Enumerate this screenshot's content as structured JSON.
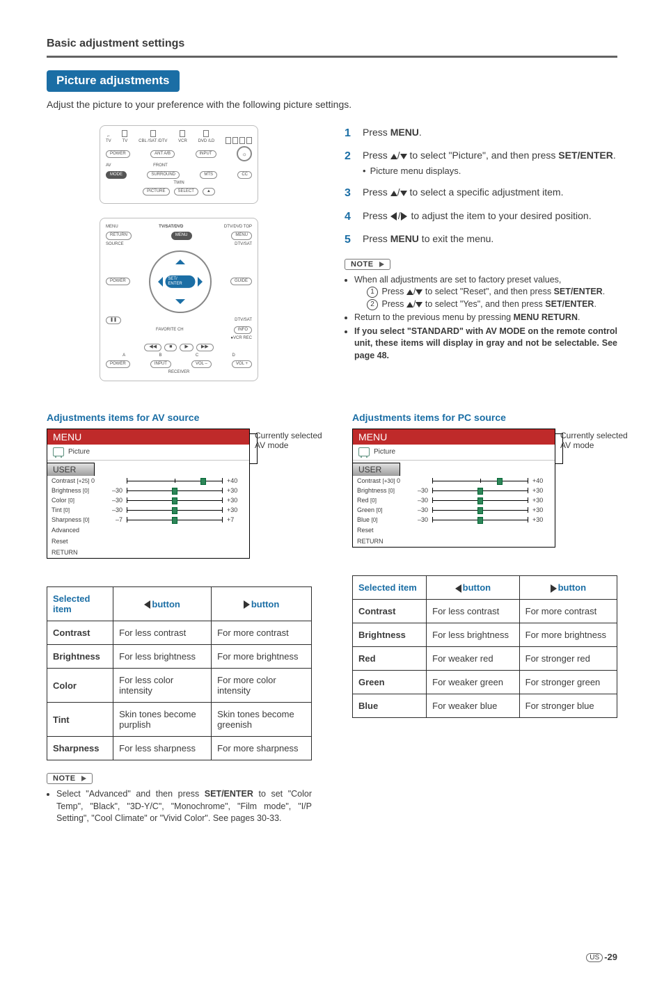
{
  "header": {
    "section_title": "Basic adjustment settings",
    "pill": "Picture adjustments",
    "intro": "Adjust the picture to your preference with the following picture settings."
  },
  "remote_top": {
    "icons": [
      "TV",
      "TV",
      "CBL /SAT /DTV",
      "VCR",
      "DVD /LD"
    ],
    "row1": [
      "POWER",
      "ANT A/B",
      "INPUT"
    ],
    "row1_group_l": "AV",
    "row1_group_r": "FRONT",
    "row2": [
      "MODE",
      "SURROUND",
      "MTS",
      "CC"
    ],
    "row3_l": "TWIN",
    "row3": [
      "PICTURE",
      "SELECT"
    ],
    "row3_tri": "▲"
  },
  "remote_bottom": {
    "top_l": "MENU",
    "top_c": "TV/SAT/DVD",
    "top_r": "DTV/DVD TOP",
    "row1": [
      "RETURN",
      "MENU",
      "MENU"
    ],
    "src": "SOURCE",
    "dtv_sat": "DTV/SAT",
    "row2": [
      "POWER",
      "GUIDE"
    ],
    "center": "SET/ ENTER",
    "info": "INFO",
    "fav": "FAVORITE CH",
    "vcr": "VCR REC",
    "transport": [
      "◀◀",
      "■",
      "▶",
      "▶▶"
    ],
    "pause": "❚❚",
    "abcd": [
      "A",
      "B",
      "C",
      "D"
    ],
    "bottom": [
      "POWER",
      "INPUT",
      "VOL –",
      "VOL +"
    ],
    "receiver": "RECEIVER"
  },
  "steps": [
    {
      "n": "1",
      "html": "Press <b>MENU</b>."
    },
    {
      "n": "2",
      "html": "Press ▲/▼ to select \"Picture\", and then press <b>SET/ENTER</b>.",
      "sub": "Picture menu displays."
    },
    {
      "n": "3",
      "html": "Press ▲/▼ to select a specific adjustment item."
    },
    {
      "n": "4",
      "html": "Press ◀/▶ to adjust the item to your desired position."
    },
    {
      "n": "5",
      "html": "Press <b>MENU</b> to exit the menu."
    }
  ],
  "note_tag": "NOTE",
  "notes_right": {
    "lead": "When all adjustments are set to factory preset values,",
    "c1": "Press ▲/▼ to select \"Reset\", and then press <b>SET/ENTER</b>.",
    "c2": "Press ▲/▼ to select \"Yes\", and then press <b>SET/ENTER</b>.",
    "b3": "Return to the previous menu by pressing <b>MENU RETURN</b>.",
    "b4": "<b>If you select \"STANDARD\" with AV MODE on the remote control unit, these items will display in gray and not be selectable. See page 48.</b>"
  },
  "notes_left": {
    "text": "Select \"Advanced\" and then press <b>SET/ENTER</b> to set \"Color Temp\", \"Black\", \"3D-Y/C\", \"Monochrome\", \"Film mode\", \"I/P Setting\", \"Cool Climate\" or \"Vivid Color\". See pages 30-33."
  },
  "av_title": "Adjustments items for AV source",
  "pc_title": "Adjustments items for PC source",
  "osd_common": {
    "menubar": "MENU",
    "picture": "Picture",
    "usertab": "USER",
    "side1": "Currently selected",
    "side2": "AV mode"
  },
  "osd_av": {
    "rows": [
      {
        "label": "Contrast",
        "val": "[+25]",
        "cur": "0",
        "min": "",
        "max": "+40",
        "pos": 0.8
      },
      {
        "label": "Brightness",
        "val": "[0]",
        "cur": "",
        "min": "–30",
        "max": "+30",
        "pos": 0.5
      },
      {
        "label": "Color",
        "val": "[0]",
        "cur": "",
        "min": "–30",
        "max": "+30",
        "pos": 0.5
      },
      {
        "label": "Tint",
        "val": "[0]",
        "cur": "",
        "min": "–30",
        "max": "+30",
        "pos": 0.5
      },
      {
        "label": "Sharpness",
        "val": "[0]",
        "cur": "",
        "min": "–7",
        "max": "+7",
        "pos": 0.5
      }
    ],
    "plain": [
      "Advanced",
      "Reset",
      "RETURN"
    ]
  },
  "osd_pc": {
    "rows": [
      {
        "label": "Contrast",
        "val": "[+30]",
        "cur": "0",
        "min": "",
        "max": "+40",
        "pos": 0.7
      },
      {
        "label": "Brightness",
        "val": "[0]",
        "cur": "",
        "min": "–30",
        "max": "+30",
        "pos": 0.5
      },
      {
        "label": "Red",
        "val": "[0]",
        "cur": "",
        "min": "–30",
        "max": "+30",
        "pos": 0.5
      },
      {
        "label": "Green",
        "val": "[0]",
        "cur": "",
        "min": "–30",
        "max": "+30",
        "pos": 0.5
      },
      {
        "label": "Blue",
        "val": "[0]",
        "cur": "",
        "min": "–30",
        "max": "+30",
        "pos": 0.5
      }
    ],
    "plain": [
      "Reset",
      "RETURN"
    ]
  },
  "table_hdr": {
    "sel": "Selected item",
    "lbtn": "button",
    "rbtn": "button"
  },
  "table_av": [
    {
      "item": "Contrast",
      "l": "For less contrast",
      "r": "For more contrast"
    },
    {
      "item": "Brightness",
      "l": "For less brightness",
      "r": "For more brightness"
    },
    {
      "item": "Color",
      "l": "For less color intensity",
      "r": "For more color intensity"
    },
    {
      "item": "Tint",
      "l": "Skin tones become purplish",
      "r": "Skin tones become greenish"
    },
    {
      "item": "Sharpness",
      "l": "For less sharpness",
      "r": "For more sharpness"
    }
  ],
  "table_pc": [
    {
      "item": "Contrast",
      "l": "For less contrast",
      "r": "For more contrast"
    },
    {
      "item": "Brightness",
      "l": "For less brightness",
      "r": "For more brightness"
    },
    {
      "item": "Red",
      "l": "For weaker red",
      "r": "For stronger red"
    },
    {
      "item": "Green",
      "l": "For weaker green",
      "r": "For stronger green"
    },
    {
      "item": "Blue",
      "l": "For weaker blue",
      "r": "For stronger blue"
    }
  ],
  "footer": {
    "region": "US",
    "page": "-29"
  }
}
